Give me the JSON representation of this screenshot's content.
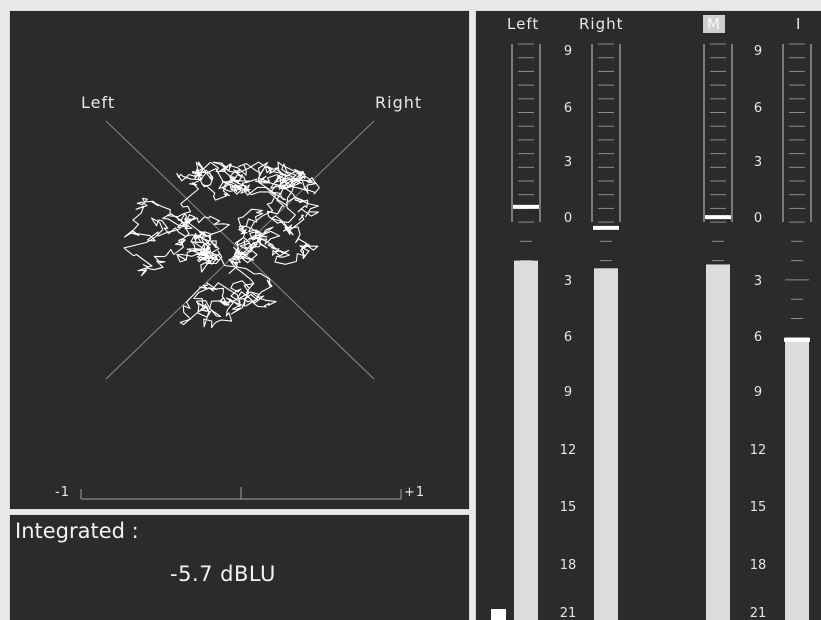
{
  "scope": {
    "left_label": "Left",
    "right_label": "Right",
    "scale_min": "-1",
    "scale_max": "+1"
  },
  "integrated": {
    "label": "Integrated :",
    "value": "-5.7  dBLU"
  },
  "meters": {
    "headers": [
      "Left",
      "Right",
      "M",
      "I"
    ],
    "scale_labels": [
      "9",
      "6",
      "3",
      "0",
      "3",
      "6",
      "9",
      "12",
      "15",
      "18",
      "21"
    ],
    "levels": {
      "left": {
        "peak_hold": 0.5,
        "bar_top": 2.0
      },
      "right": {
        "peak_hold": -0.2,
        "bar_top": 2.4
      },
      "m": {
        "peak_hold": 0.2,
        "bar_top": 2.2
      },
      "i": {
        "peak_hold": -6.0,
        "bar_top": 6.0
      }
    }
  },
  "colors": {
    "panel_bg": "#2b2b2b",
    "border": "#d8d8d8",
    "bar_fill": "#dcdcdc",
    "text": "#e8e8e8"
  }
}
